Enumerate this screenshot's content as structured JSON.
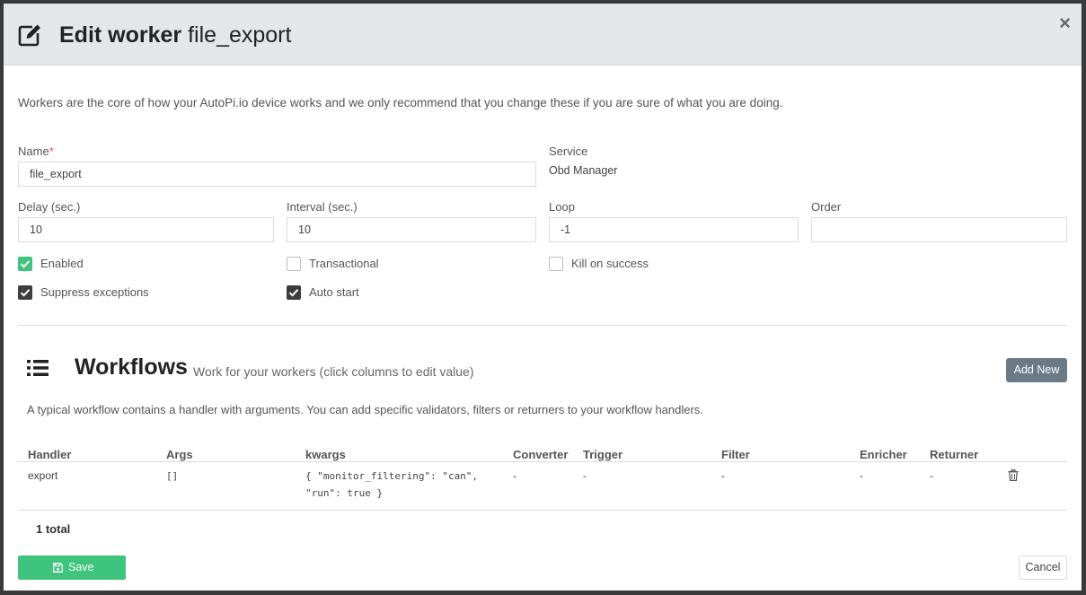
{
  "header": {
    "title_bold": "Edit worker",
    "title_name": "file_export",
    "close_label": "×"
  },
  "intro": "Workers are the core of how your AutoPi.io device works and we only recommend that you change these if you are sure of what you are doing.",
  "form": {
    "name_label": "Name",
    "name_required": "*",
    "name_value": "file_export",
    "service_label": "Service",
    "service_value": "Obd Manager",
    "delay_label": "Delay (sec.)",
    "delay_value": "10",
    "interval_label": "Interval (sec.)",
    "interval_value": "10",
    "loop_label": "Loop",
    "loop_value": "-1",
    "order_label": "Order",
    "order_value": "",
    "checkboxes": {
      "enabled": "Enabled",
      "transactional": "Transactional",
      "kill_on_success": "Kill on success",
      "suppress_exceptions": "Suppress exceptions",
      "auto_start": "Auto start"
    }
  },
  "workflows": {
    "title": "Workflows",
    "subtitle": "Work for your workers (click columns to edit value)",
    "add_new_label": "Add New",
    "description": "A typical workflow contains a handler with arguments. You can add specific validators, filters or returners to your workflow handlers.",
    "columns": [
      "Handler",
      "Args",
      "kwargs",
      "Converter",
      "Trigger",
      "Filter",
      "Enricher",
      "Returner"
    ],
    "rows": [
      {
        "handler": "export",
        "args": "[]",
        "kwargs_line1": "{ \"monitor_filtering\": \"can\",",
        "kwargs_line2": "\"run\": true }",
        "converter": "-",
        "trigger": "-",
        "filter": "-",
        "enricher": "-",
        "returner": "-"
      }
    ],
    "total": "1 total"
  },
  "footer": {
    "save_label": "Save",
    "cancel_label": "Cancel"
  },
  "colors": {
    "accent_green": "#3ec47c",
    "add_button": "#6b7a87",
    "header_bg": "#e4e6e8"
  }
}
